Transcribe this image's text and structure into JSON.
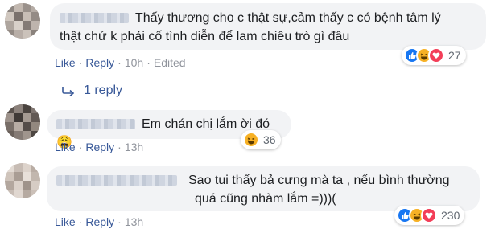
{
  "comments": [
    {
      "text_line1": "Thấy thương cho c thật sự,cảm thấy c có bệnh tâm lý",
      "text_line2": "thật chứ k phải cố tình diễn để lam chiêu trò gì đâu",
      "like": "Like",
      "reply": "Reply",
      "time": "10h",
      "edited": "Edited",
      "reaction_count": "27",
      "reactions": [
        "like-icon",
        "haha-icon",
        "love-icon"
      ],
      "replies_label": "1 reply"
    },
    {
      "text_line1": "Em chán chị lắm ời đó 😩",
      "like": "Like",
      "reply": "Reply",
      "time": "13h",
      "reaction_count": "36",
      "reactions": [
        "haha-icon"
      ]
    },
    {
      "text_line1": "Sao tui thấy bả cưng mà ta , nếu bình thường",
      "text_line2": "quá cũng nhàm lắm =)))(",
      "like": "Like",
      "reply": "Reply",
      "time": "13h",
      "reaction_count": "230",
      "reactions": [
        "like-icon",
        "haha-icon",
        "love-icon"
      ]
    }
  ],
  "separator": "·",
  "colors": {
    "link": "#385898",
    "bubble": "#f2f3f5",
    "like": "#1877f2",
    "love": "#f33e58",
    "haha": "#f7b125"
  }
}
